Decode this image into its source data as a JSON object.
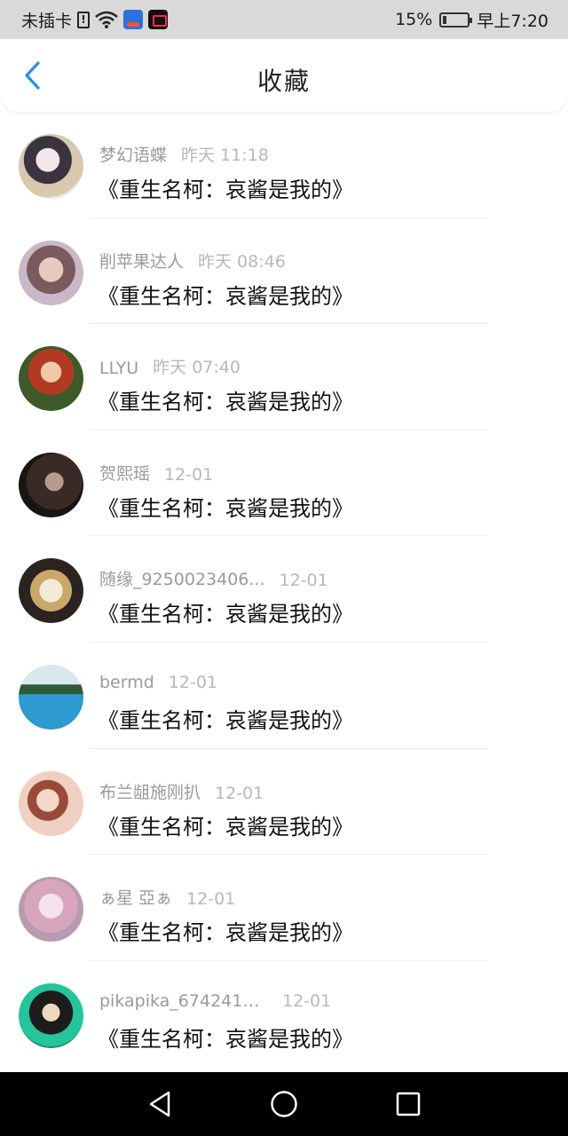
{
  "status_bar": {
    "carrier": "未插卡",
    "battery_percent": "15%",
    "battery_level": 0.15,
    "time": "早上7:20",
    "icons": [
      "sim-alert-icon",
      "wifi-icon",
      "app-notification-icon",
      "video-app-icon",
      "battery-icon"
    ]
  },
  "header": {
    "title": "收藏",
    "back_icon": "chevron-left-icon",
    "accent_color": "#2b8ce8"
  },
  "favorites": [
    {
      "name": "梦幻语蝶",
      "time": "昨天 11:18",
      "title": "《重生名柯：哀酱是我的》"
    },
    {
      "name": "削苹果达人",
      "time": "昨天 08:46",
      "title": "《重生名柯：哀酱是我的》"
    },
    {
      "name": "LLYU",
      "time": "昨天 07:40",
      "title": "《重生名柯：哀酱是我的》"
    },
    {
      "name": "贺熙瑶",
      "time": "12-01",
      "title": "《重生名柯：哀酱是我的》"
    },
    {
      "name": "随缘_9250023406...",
      "time": "12-01",
      "title": "《重生名柯：哀酱是我的》"
    },
    {
      "name": "bermd",
      "time": "12-01",
      "title": "《重生名柯：哀酱是我的》"
    },
    {
      "name": "布兰龃施刚扒",
      "time": "12-01",
      "title": "《重生名柯：哀酱是我的》"
    },
    {
      "name": "ぁ星 亞ぁ",
      "time": "12-01",
      "title": "《重生名柯：哀酱是我的》"
    },
    {
      "name": "pikapika_6742411...",
      "time": "12-01",
      "title": "《重生名柯：哀酱是我的》"
    }
  ],
  "system_nav": {
    "buttons": [
      "back-triangle-icon",
      "home-circle-icon",
      "recents-square-icon"
    ]
  }
}
